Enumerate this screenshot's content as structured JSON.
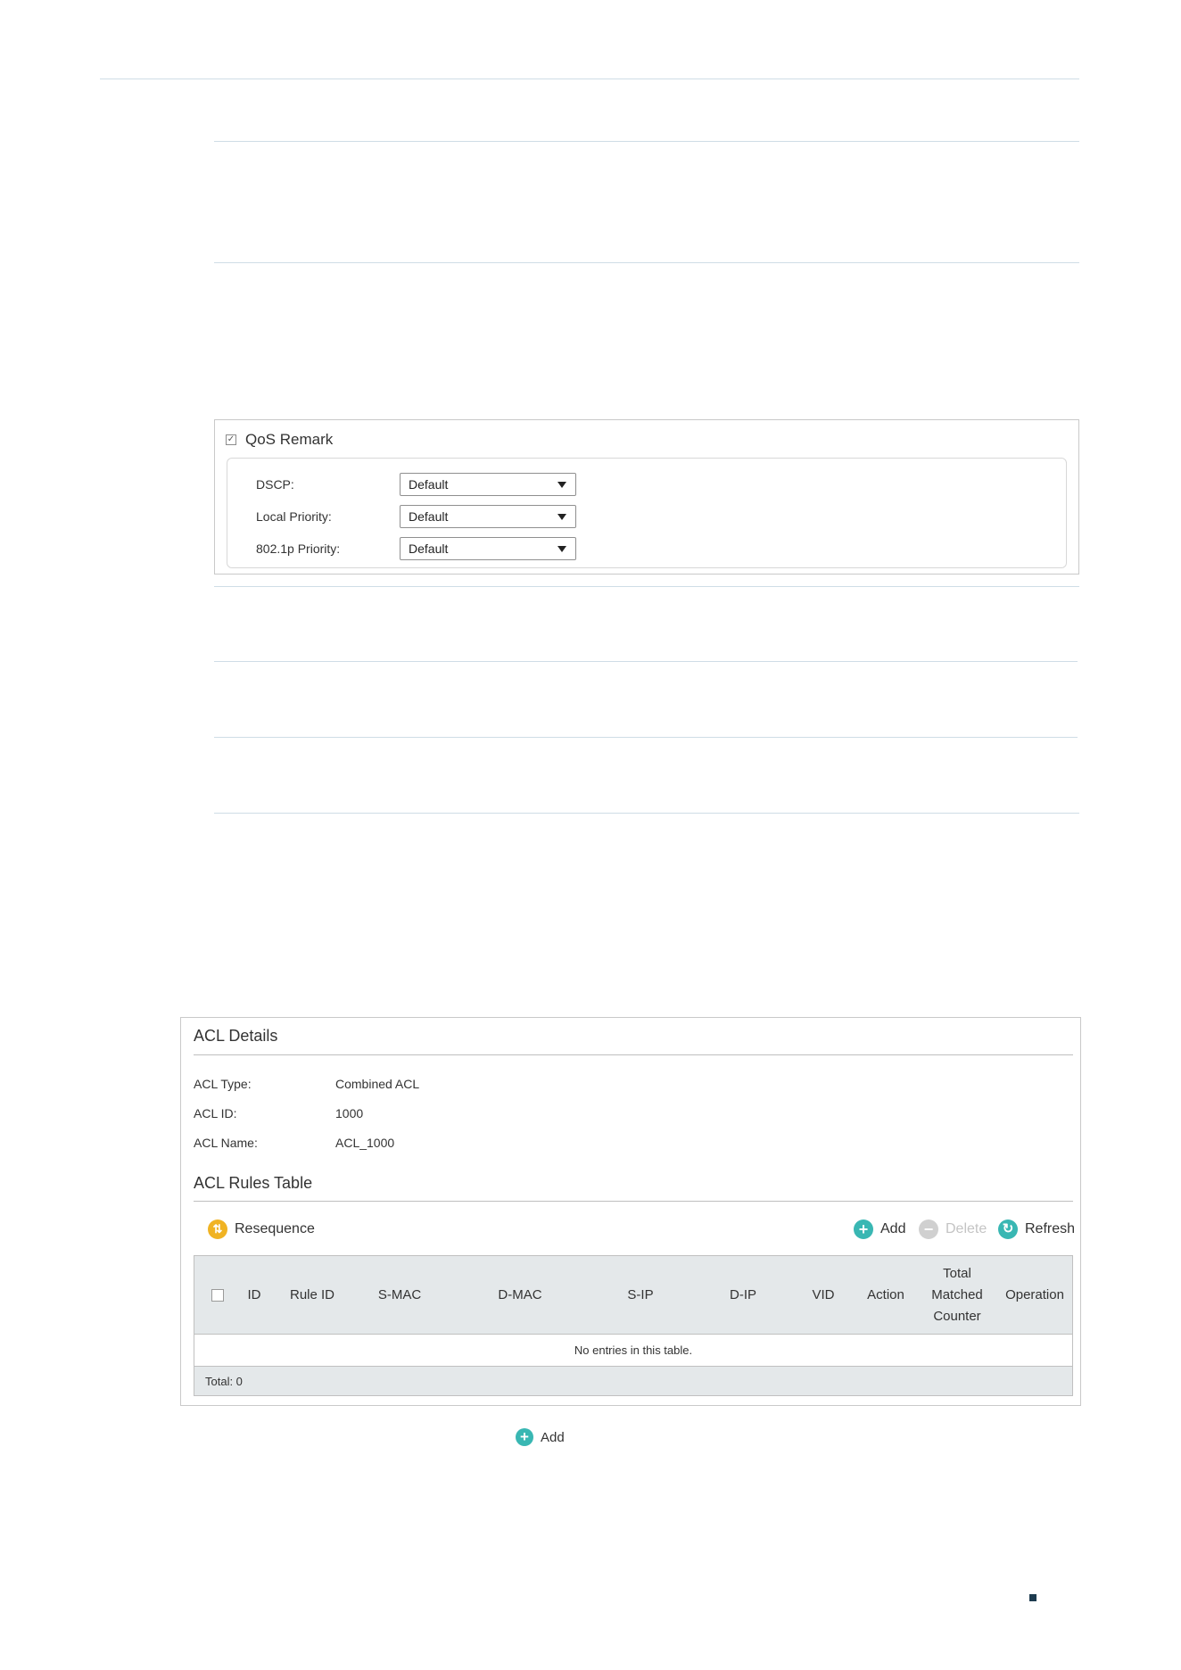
{
  "qos_remark": {
    "title": "QoS Remark",
    "checked": true,
    "rows": [
      {
        "label": "DSCP:",
        "value": "Default"
      },
      {
        "label": "Local Priority:",
        "value": "Default"
      },
      {
        "label": "802.1p Priority:",
        "value": "Default"
      }
    ]
  },
  "acl_details": {
    "title": "ACL Details",
    "type_label": "ACL Type:",
    "type_value": "Combined ACL",
    "id_label": "ACL ID:",
    "id_value": "1000",
    "name_label": "ACL Name:",
    "name_value": "ACL_1000"
  },
  "acl_rules": {
    "title": "ACL Rules Table",
    "resequence_label": "Resequence",
    "add_label": "Add",
    "delete_label": "Delete",
    "refresh_label": "Refresh",
    "columns": [
      "ID",
      "Rule ID",
      "S-MAC",
      "D-MAC",
      "S-IP",
      "D-IP",
      "VID",
      "Action",
      "Total Matched Counter",
      "Operation"
    ],
    "empty_text": "No entries in this table.",
    "total_text": "Total: 0"
  },
  "bottom_add_label": "Add",
  "colors": {
    "rule_line": "#cfdde6",
    "teal": "#39b7b3",
    "orange": "#f0b323",
    "grey_disabled": "#d0d0d0",
    "header_bg": "#e4e8ea"
  }
}
